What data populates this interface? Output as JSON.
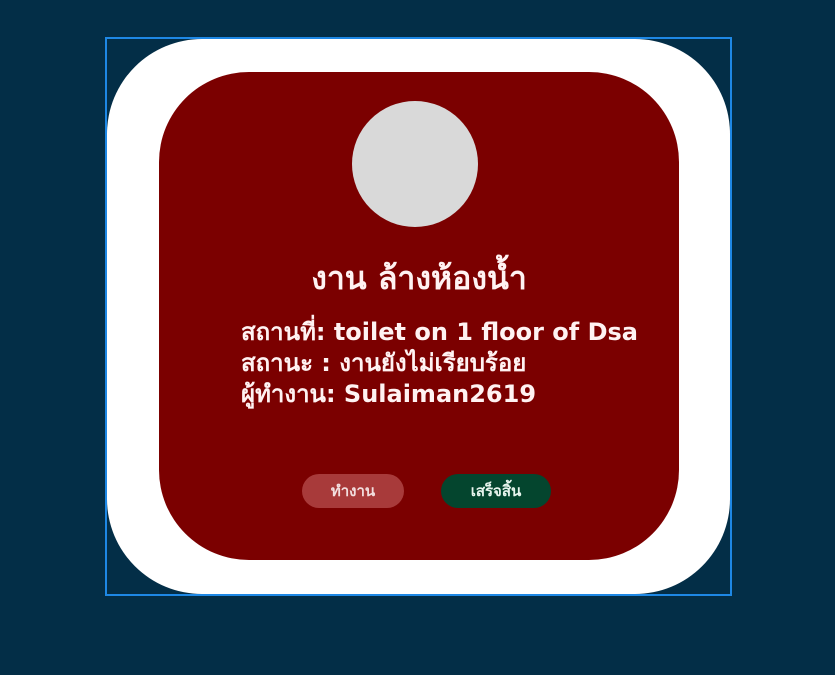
{
  "task_card": {
    "title": "งาน ล้างห้องน้ำ",
    "location_label": "สถานที่: toilet on 1 floor of Dsa",
    "status_label": "สถานะ : งานยังไม่เรียบร้อย",
    "worker_label": "ผู้ทำงาน: Sulaiman2619"
  },
  "buttons": {
    "work_label": "ทำงาน",
    "done_label": "เสร็จสิ้น"
  },
  "colors": {
    "background": "#032e47",
    "outer_card": "#ffffff",
    "inner_card": "#7b0000",
    "work_button": "#a83a3a",
    "done_button": "#04452e",
    "selection": "#1e88e5"
  }
}
